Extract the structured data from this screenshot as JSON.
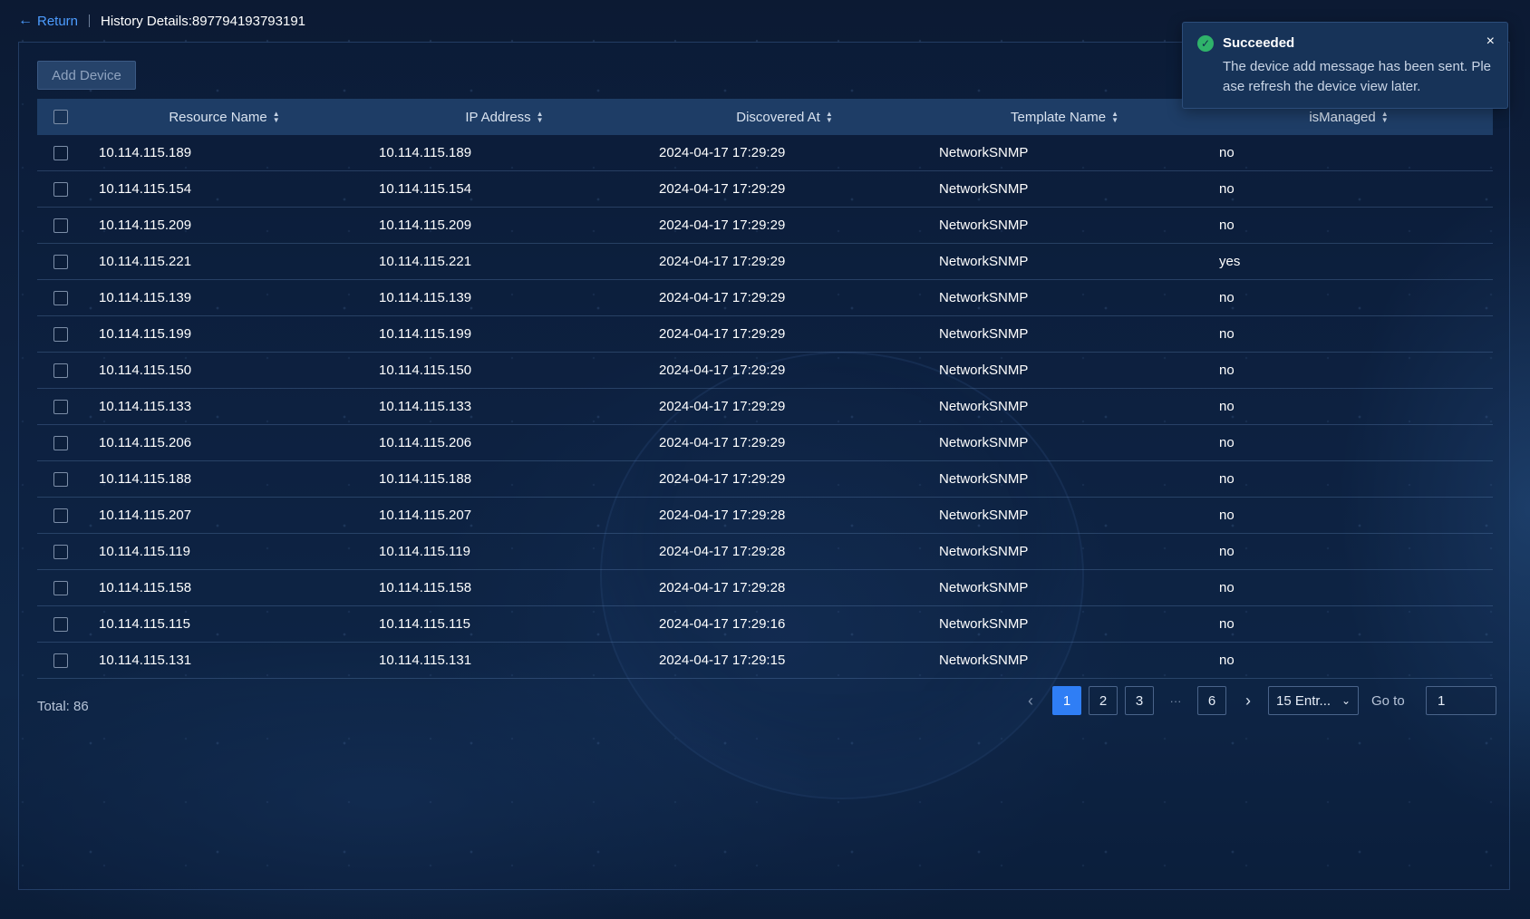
{
  "header": {
    "return_label": "Return",
    "title": "History Details:897794193793191"
  },
  "toolbar": {
    "add_device_label": "Add Device"
  },
  "table": {
    "columns": [
      "Resource Name",
      "IP Address",
      "Discovered At",
      "Template Name",
      "isManaged"
    ],
    "rows": [
      [
        "10.114.115.189",
        "10.114.115.189",
        "2024-04-17 17:29:29",
        "NetworkSNMP",
        "no"
      ],
      [
        "10.114.115.154",
        "10.114.115.154",
        "2024-04-17 17:29:29",
        "NetworkSNMP",
        "no"
      ],
      [
        "10.114.115.209",
        "10.114.115.209",
        "2024-04-17 17:29:29",
        "NetworkSNMP",
        "no"
      ],
      [
        "10.114.115.221",
        "10.114.115.221",
        "2024-04-17 17:29:29",
        "NetworkSNMP",
        "yes"
      ],
      [
        "10.114.115.139",
        "10.114.115.139",
        "2024-04-17 17:29:29",
        "NetworkSNMP",
        "no"
      ],
      [
        "10.114.115.199",
        "10.114.115.199",
        "2024-04-17 17:29:29",
        "NetworkSNMP",
        "no"
      ],
      [
        "10.114.115.150",
        "10.114.115.150",
        "2024-04-17 17:29:29",
        "NetworkSNMP",
        "no"
      ],
      [
        "10.114.115.133",
        "10.114.115.133",
        "2024-04-17 17:29:29",
        "NetworkSNMP",
        "no"
      ],
      [
        "10.114.115.206",
        "10.114.115.206",
        "2024-04-17 17:29:29",
        "NetworkSNMP",
        "no"
      ],
      [
        "10.114.115.188",
        "10.114.115.188",
        "2024-04-17 17:29:29",
        "NetworkSNMP",
        "no"
      ],
      [
        "10.114.115.207",
        "10.114.115.207",
        "2024-04-17 17:29:28",
        "NetworkSNMP",
        "no"
      ],
      [
        "10.114.115.119",
        "10.114.115.119",
        "2024-04-17 17:29:28",
        "NetworkSNMP",
        "no"
      ],
      [
        "10.114.115.158",
        "10.114.115.158",
        "2024-04-17 17:29:28",
        "NetworkSNMP",
        "no"
      ],
      [
        "10.114.115.115",
        "10.114.115.115",
        "2024-04-17 17:29:16",
        "NetworkSNMP",
        "no"
      ],
      [
        "10.114.115.131",
        "10.114.115.131",
        "2024-04-17 17:29:15",
        "NetworkSNMP",
        "no"
      ]
    ]
  },
  "footer": {
    "total_label": "Total: 86",
    "pages": [
      "1",
      "2",
      "3",
      "6"
    ],
    "active_page": "1",
    "ellipsis": "···",
    "page_size": "15 Entr...",
    "goto_label": "Go to",
    "goto_value": "1"
  },
  "toast": {
    "title": "Succeeded",
    "message": "The device add message has been sent. Please refresh the device view later.",
    "close_glyph": "×"
  },
  "colors": {
    "accent": "#2f7ef5",
    "link": "#4c9cff",
    "success": "#2fb36a"
  }
}
